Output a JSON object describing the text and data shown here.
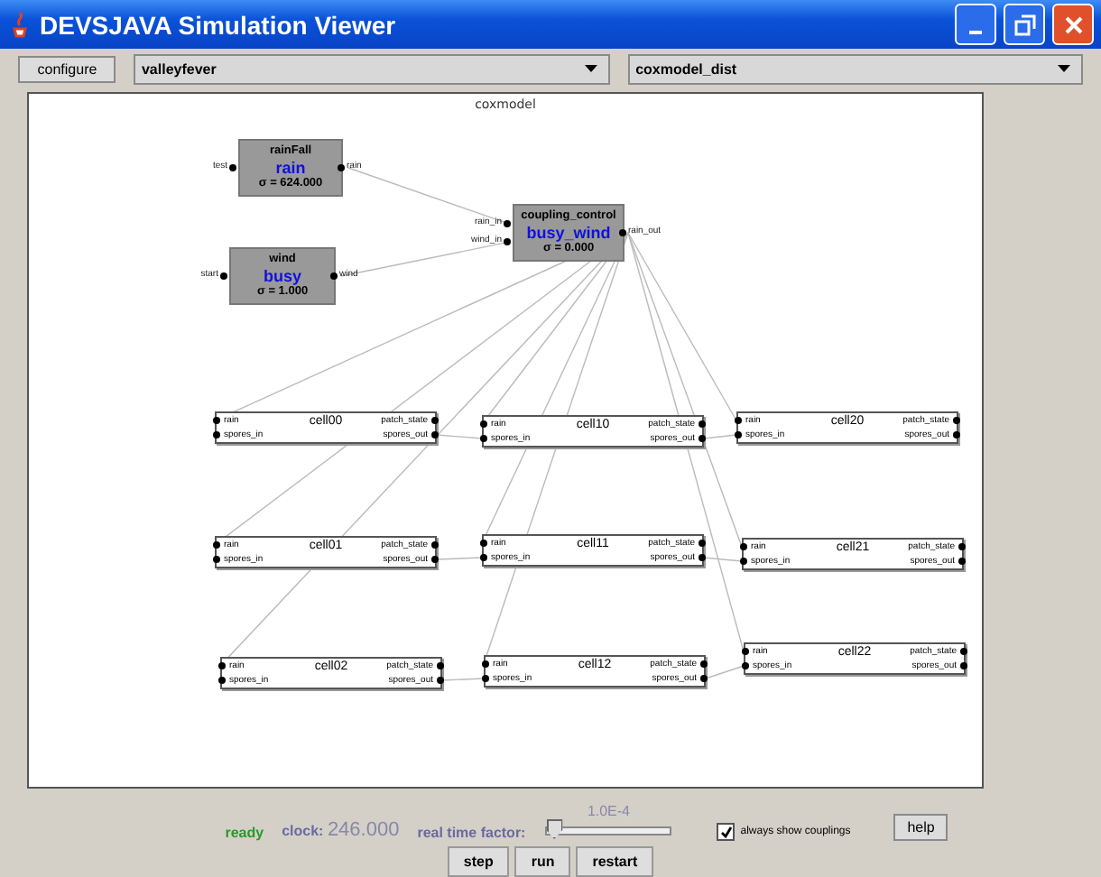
{
  "window": {
    "title": "DEVSJAVA Simulation Viewer"
  },
  "toolbar": {
    "configure_button": "configure",
    "package_select": "valleyfever",
    "model_select": "coxmodel_dist"
  },
  "diagram": {
    "title": "coxmodel",
    "atomic_models": [
      {
        "name": "rainFall",
        "phase": "rain",
        "sigma": "σ = 624.000",
        "inports": [
          "test"
        ],
        "outports": [
          "rain"
        ]
      },
      {
        "name": "wind",
        "phase": "busy",
        "sigma": "σ = 1.000",
        "inports": [
          "start"
        ],
        "outports": [
          "wind"
        ]
      },
      {
        "name": "coupling_control",
        "phase": "busy_wind",
        "sigma": "σ = 0.000",
        "inports": [
          "rain_in",
          "wind_in"
        ],
        "outports": [
          "rain_out"
        ]
      }
    ],
    "cells": [
      {
        "name": "cell00",
        "inports": [
          "rain",
          "spores_in"
        ],
        "outports": [
          "patch_state",
          "spores_out"
        ]
      },
      {
        "name": "cell01",
        "inports": [
          "rain",
          "spores_in"
        ],
        "outports": [
          "patch_state",
          "spores_out"
        ]
      },
      {
        "name": "cell02",
        "inports": [
          "rain",
          "spores_in"
        ],
        "outports": [
          "patch_state",
          "spores_out"
        ]
      },
      {
        "name": "cell10",
        "inports": [
          "rain",
          "spores_in"
        ],
        "outports": [
          "patch_state",
          "spores_out"
        ]
      },
      {
        "name": "cell11",
        "inports": [
          "rain",
          "spores_in"
        ],
        "outports": [
          "patch_state",
          "spores_out"
        ]
      },
      {
        "name": "cell12",
        "inports": [
          "rain",
          "spores_in"
        ],
        "outports": [
          "patch_state",
          "spores_out"
        ]
      },
      {
        "name": "cell20",
        "inports": [
          "rain",
          "spores_in"
        ],
        "outports": [
          "patch_state",
          "spores_out"
        ]
      },
      {
        "name": "cell21",
        "inports": [
          "rain",
          "spores_in"
        ],
        "outports": [
          "patch_state",
          "spores_out"
        ]
      },
      {
        "name": "cell22",
        "inports": [
          "rain",
          "spores_in"
        ],
        "outports": [
          "patch_state",
          "spores_out"
        ]
      }
    ]
  },
  "controls": {
    "status": "ready",
    "clock_label": "clock:",
    "clock_value": "246.000",
    "rtf_label": "real time factor:",
    "rtf_value": "1.0E-4",
    "rtf_slider": {
      "level": 0.05
    },
    "show_couplings": {
      "label": "always show couplings",
      "checked": true
    },
    "help_button": "help",
    "buttons": [
      "step",
      "run",
      "restart"
    ]
  }
}
